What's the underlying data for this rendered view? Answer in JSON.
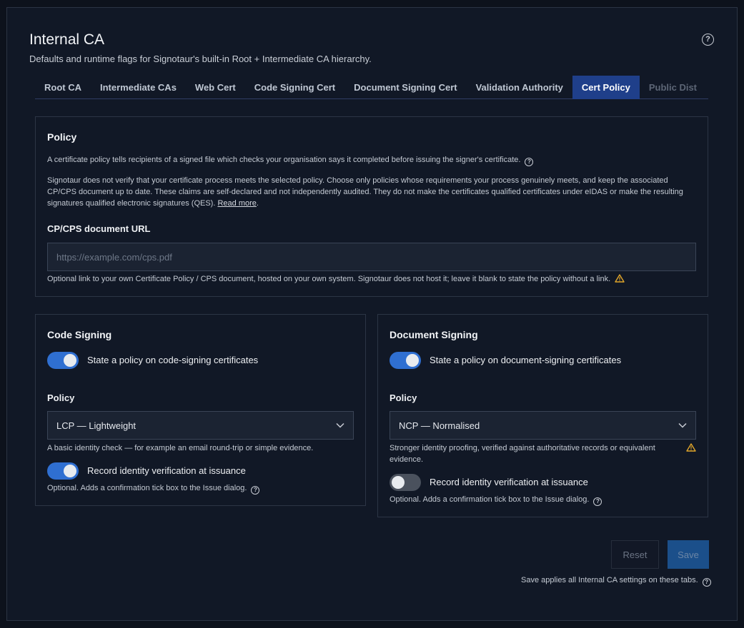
{
  "header": {
    "title": "Internal CA",
    "subtitle": "Defaults and runtime flags for Signotaur's built-in Root + Intermediate CA hierarchy.",
    "help_icon": "question-circle-icon"
  },
  "tabs": [
    {
      "label": "Root CA",
      "state": "normal"
    },
    {
      "label": "Intermediate CAs",
      "state": "normal"
    },
    {
      "label": "Web Cert",
      "state": "normal"
    },
    {
      "label": "Code Signing Cert",
      "state": "normal"
    },
    {
      "label": "Document Signing Cert",
      "state": "normal"
    },
    {
      "label": "Validation Authority",
      "state": "normal"
    },
    {
      "label": "Cert Policy",
      "state": "active"
    },
    {
      "label": "Public Dist",
      "state": "disabled"
    }
  ],
  "policy": {
    "heading": "Policy",
    "intro": "A certificate policy tells recipients of a signed file which checks your organisation says it completed before issuing the signer's certificate.",
    "disclaimer": "Signotaur does not verify that your certificate process meets the selected policy. Choose only policies whose requirements your process genuinely meets, and keep the associated CP/CPS document up to date. These claims are self-declared and not independently audited. They do not make the certificates qualified certificates under eIDAS or make the resulting signatures qualified electronic signatures (QES).",
    "read_more": "Read more",
    "url_label": "CP/CPS document URL",
    "url_value": "",
    "url_placeholder": "https://example.com/cps.pdf",
    "url_help": "Optional link to your own Certificate Policy / CPS document, hosted on your own system. Signotaur does not host it; leave it blank to state the policy without a link."
  },
  "code_signing": {
    "heading": "Code Signing",
    "toggle_label": "State a policy on code-signing certificates",
    "toggle_on": true,
    "policy_label": "Policy",
    "policy_value": "LCP — Lightweight",
    "policy_help": "A basic identity check — for example an email round-trip or simple evidence.",
    "verify_label": "Record identity verification at issuance",
    "verify_on": true,
    "verify_help": "Optional. Adds a confirmation tick box to the Issue dialog."
  },
  "document_signing": {
    "heading": "Document Signing",
    "toggle_label": "State a policy on document-signing certificates",
    "toggle_on": true,
    "policy_label": "Policy",
    "policy_value": "NCP — Normalised",
    "policy_help": "Stronger identity proofing, verified against authoritative records or equivalent evidence.",
    "verify_label": "Record identity verification at issuance",
    "verify_on": false,
    "verify_help": "Optional. Adds a confirmation tick box to the Issue dialog."
  },
  "actions": {
    "reset_label": "Reset",
    "save_label": "Save",
    "note": "Save applies all Internal CA settings on these tabs."
  },
  "colors": {
    "background": "#0d121c",
    "accent": "#2f6fd1",
    "active_tab": "#1f3f8a",
    "warning": "#e0a52a"
  }
}
